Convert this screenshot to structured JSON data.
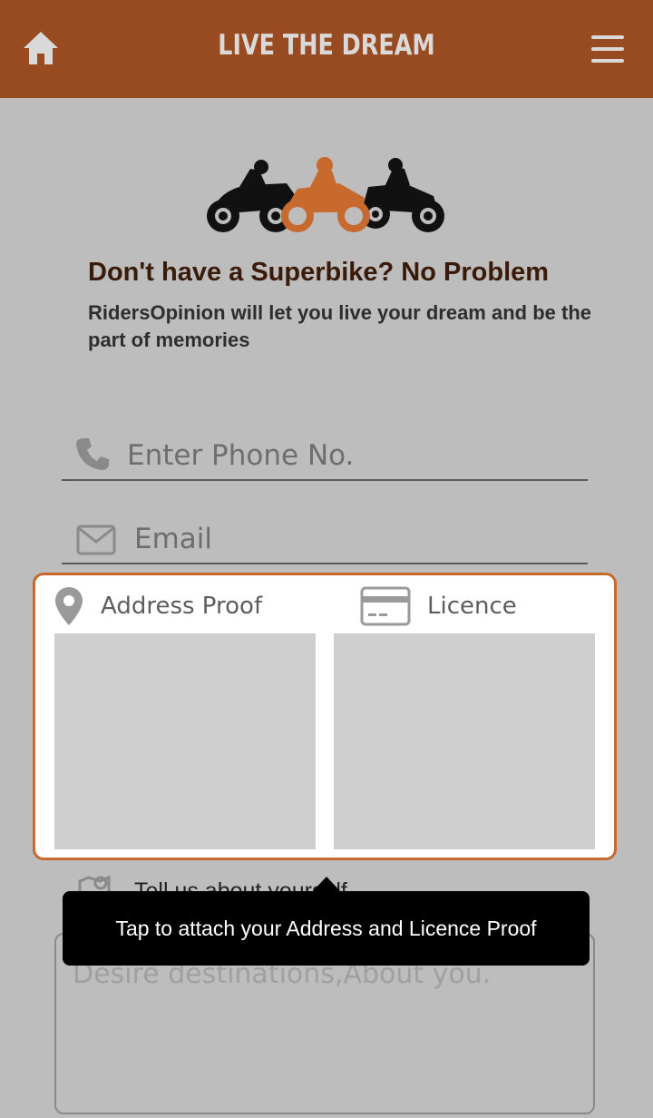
{
  "header": {
    "title": "LIVE THE DREAM",
    "home_icon": "home-icon",
    "menu_icon": "hamburger-menu-icon",
    "background_color": "#984a20"
  },
  "hero": {
    "illustration": "three-riders-on-motorbikes",
    "headline": "Don't have a Superbike? No Problem",
    "subtitle": "RidersOpinion will let you live your dream and be the part of memories"
  },
  "form": {
    "phone": {
      "icon": "phone-icon",
      "placeholder": "Enter Phone No.",
      "value": ""
    },
    "email": {
      "icon": "mail-icon",
      "placeholder": "Email",
      "value": ""
    },
    "documents": {
      "address_proof": {
        "icon": "location-pin-icon",
        "label": "Address Proof"
      },
      "licence": {
        "icon": "id-card-icon",
        "label": "Licence"
      },
      "accent_color": "#c8692e"
    },
    "about": {
      "icon": "map-icon",
      "label": "Tell us about yourself",
      "placeholder": "Desire destinations,About you.",
      "value": ""
    }
  },
  "tooltip": {
    "text": "Tap to attach your Address and Licence Proof"
  }
}
